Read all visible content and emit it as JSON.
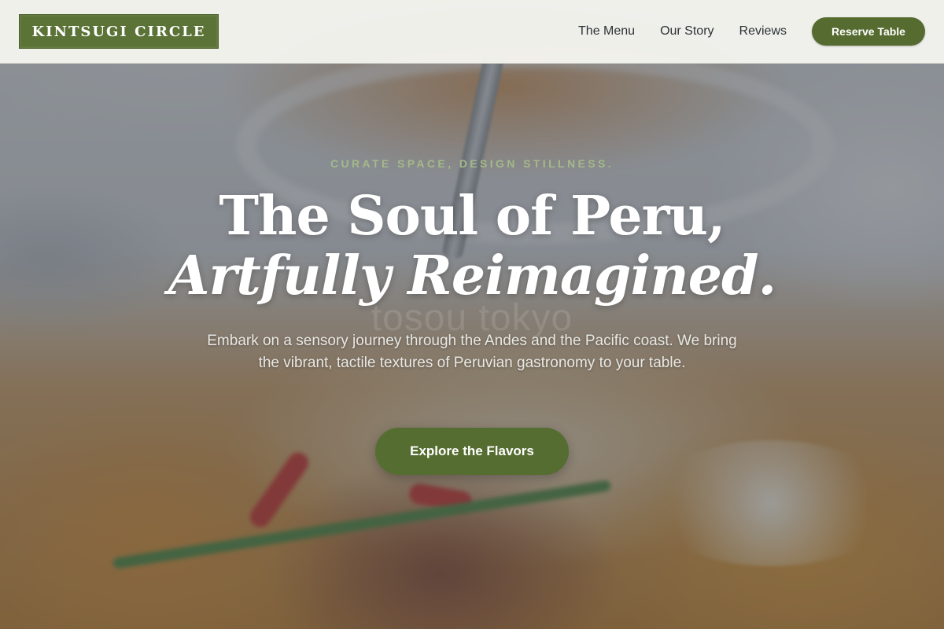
{
  "header": {
    "logo_text": "KINTSUGI CIRCLE",
    "nav": [
      {
        "label": "The Menu"
      },
      {
        "label": "Our Story"
      },
      {
        "label": "Reviews"
      }
    ],
    "reserve_label": "Reserve Table"
  },
  "hero": {
    "tagline": "CURATE SPACE, DESIGN STILLNESS.",
    "headline_line1": "The Soul of Peru,",
    "headline_line2": "Artfully Reimagined.",
    "watermark": "tosou tokyo",
    "description": "Embark on a sensory journey through the Andes and the Pacific coast. We bring the vibrant, tactile textures of Peruvian gastronomy to your table.",
    "cta_label": "Explore the Flavors"
  },
  "colors": {
    "brand_green": "#5b7336",
    "button_green": "#556b2f",
    "tagline_green": "#a4b98a",
    "header_bg": "#f4f4ee",
    "nav_text": "#2d3236"
  }
}
